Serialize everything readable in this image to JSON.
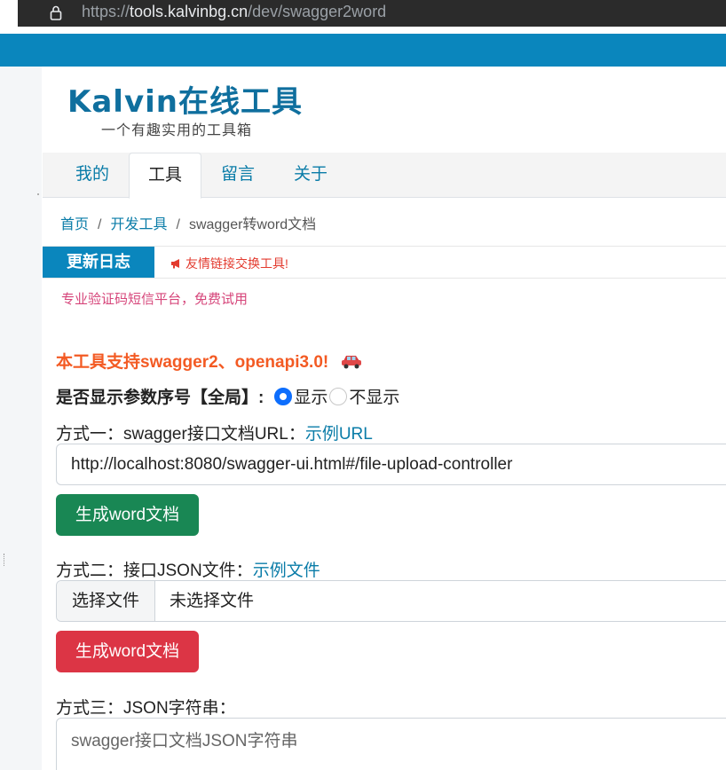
{
  "browser": {
    "url_scheme": "https://",
    "url_host": "tools.kalvinbg.cn",
    "url_path": "/dev/swagger2word"
  },
  "header": {
    "logo_title": "Kalvin在线工具",
    "logo_subtitle": "一个有趣实用的工具箱"
  },
  "nav": {
    "tabs": [
      {
        "label": "我的",
        "active": false
      },
      {
        "label": "工具",
        "active": true
      },
      {
        "label": "留言",
        "active": false
      },
      {
        "label": "关于",
        "active": false
      }
    ]
  },
  "breadcrumb": {
    "home": "首页",
    "sep": "/",
    "dev": "开发工具",
    "current": "swagger转word文档"
  },
  "changelog": {
    "label": "更新日志",
    "notice": "友情链接交换工具!"
  },
  "ad_text": "专业验证码短信平台，免费试用",
  "support_text": "本工具支持swagger2、openapi3.0!",
  "options": {
    "label": "是否显示参数序号【全局】:",
    "show": "显示",
    "hide": "不显示",
    "selected": "显示"
  },
  "method1": {
    "label": "方式一：swagger接口文档URL：",
    "link": "示例URL",
    "url_value": "http://localhost:8080/swagger-ui.html#/file-upload-controller",
    "button": "生成word文档"
  },
  "method2": {
    "label": "方式二：接口JSON文件：",
    "link": "示例文件",
    "file_button": "选择文件",
    "file_status": "未选择文件",
    "button": "生成word文档"
  },
  "method3": {
    "label": "方式三：JSON字符串：",
    "placeholder": "swagger接口文档JSON字符串"
  },
  "colors": {
    "brand_blue": "#0a86bd",
    "link": "#0a7ca8",
    "accent_orange": "#f35a23",
    "btn_green": "#198754",
    "btn_red": "#dc3545"
  }
}
